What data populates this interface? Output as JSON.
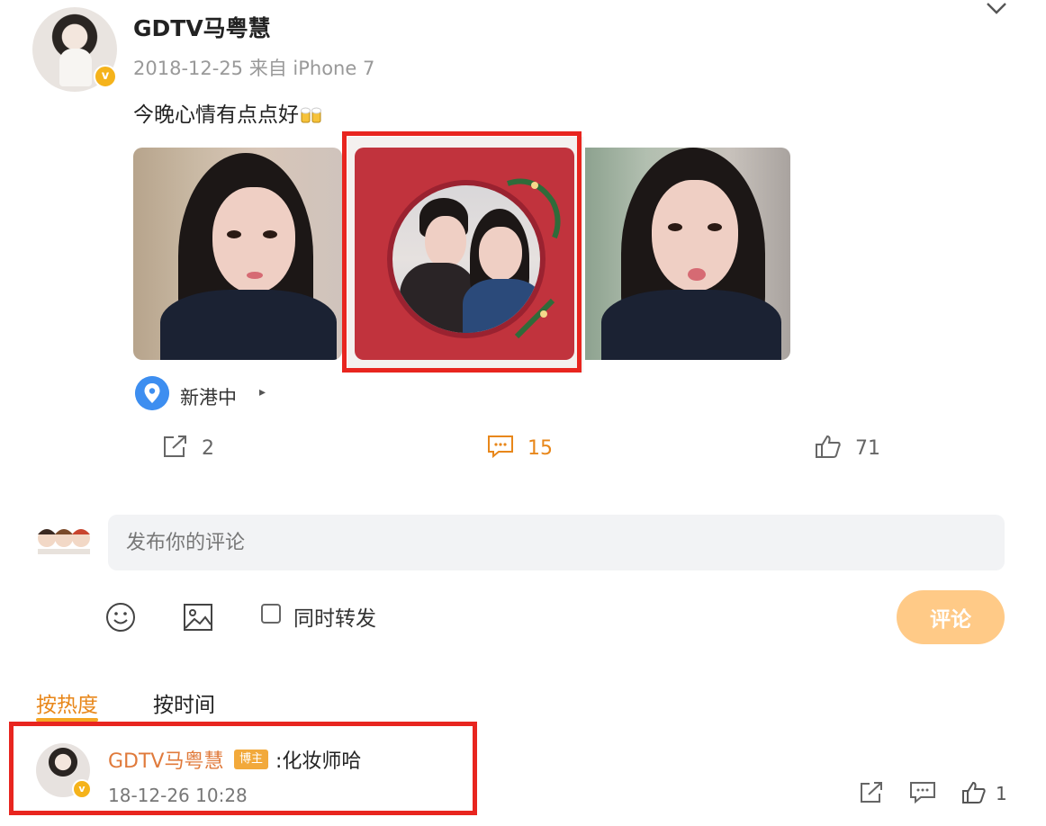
{
  "post": {
    "author": "GDTV马粤慧",
    "verified_badge": "v",
    "meta": "2018-12-25 来自 iPhone 7",
    "text": "今晚心情有点点好",
    "location": "新港中",
    "location_arrow": "▸"
  },
  "actions": {
    "repost_count": "2",
    "comment_count": "15",
    "like_count": "71"
  },
  "composer": {
    "placeholder": "发布你的评论",
    "repost_checkbox_label": "同时转发",
    "submit_label": "评论"
  },
  "sort_tabs": {
    "hot": "按热度",
    "time": "按时间"
  },
  "comment": {
    "author": "GDTV马粤慧",
    "badge": "博主",
    "text": ":化妆师哈",
    "time": "18-12-26 10:28",
    "like_count": "1"
  },
  "colors": {
    "accent_orange": "#e8871a",
    "highlight_red": "#e8251f",
    "submit_bg": "#ffca87",
    "location_blue": "#3d8ef0"
  }
}
